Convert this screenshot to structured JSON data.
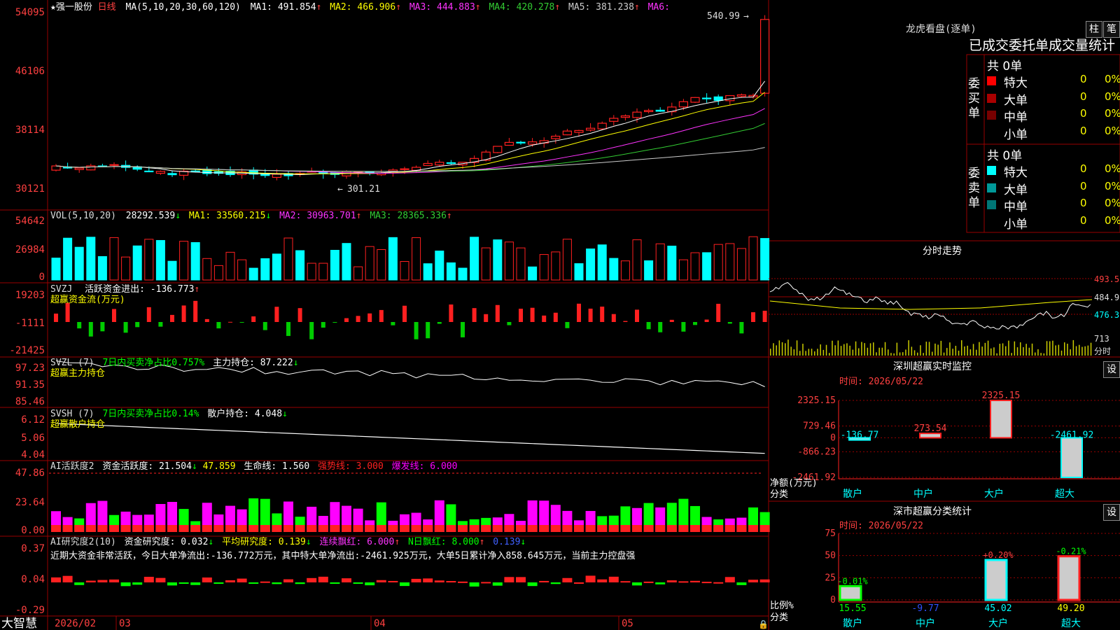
{
  "stock": {
    "name": "★强一股份",
    "period": "日线",
    "ma_label": "MA(5,10,20,30,60,120)"
  },
  "colors": {
    "up": "#ff2020",
    "down": "#00ffff",
    "ma1": "#ffffff",
    "ma2": "#ffff00",
    "ma3": "#ff33ff",
    "ma4": "#33cc33",
    "ma5": "#cccccc",
    "grid": "#800000",
    "magenta": "#ff00ff",
    "green": "#00ff00"
  },
  "main": {
    "y_ticks": [
      "54095",
      "46106",
      "38114",
      "30121"
    ],
    "ma_items": [
      {
        "label": "MA1: 491.854",
        "arrow": "↑",
        "color": "#ffffff"
      },
      {
        "label": "MA2: 466.906",
        "arrow": "↑",
        "color": "#ffff00"
      },
      {
        "label": "MA3: 444.883",
        "arrow": "↑",
        "color": "#ff33ff"
      },
      {
        "label": "MA4: 420.278",
        "arrow": "↑",
        "color": "#33cc33"
      },
      {
        "label": "MA5: 381.238",
        "arrow": "↑",
        "color": "#cccccc"
      },
      {
        "label": "MA6:",
        "arrow": "",
        "color": "#ff33ff"
      }
    ],
    "high_label": "540.99",
    "low_label": "301.21"
  },
  "vol": {
    "title": "VOL(5,10,20)",
    "value": "28292.539",
    "v_arrow": "↓",
    "ma1": "MA1: 33560.215",
    "ma1_arrow": "↓",
    "ma2": "MA2: 30963.701",
    "ma2_arrow": "↑",
    "ma3": "MA3: 28365.336",
    "ma3_arrow": "↑",
    "y_ticks": [
      "54642",
      "26984",
      "0"
    ]
  },
  "svzj": {
    "title": "SVZJ",
    "desc": "活跃资金进出: -136.773",
    "arrow": "↑",
    "sub": "超赢资金流(万元)",
    "y_ticks": [
      "19203",
      "-1111",
      "-21425"
    ]
  },
  "svzl": {
    "title": "SVZL (7)",
    "desc": "7日内买卖净占比0.757%",
    "value": "主力持仓: 87.222",
    "arrow": "↓",
    "sub": "超赢主力持仓",
    "y_ticks": [
      "97.23",
      "91.35",
      "85.46"
    ]
  },
  "svsh": {
    "title": "SVSH (7)",
    "desc": "7日内买卖净占比0.14%",
    "value": "散户持仓: 4.048",
    "arrow": "↓",
    "sub": "超赢散户持仓",
    "y_ticks": [
      "6.12",
      "5.06",
      "4.04"
    ]
  },
  "ai1": {
    "title": "AI活跃度2",
    "desc": "资金活跃度: 21.504",
    "arrow": "↓",
    "v2": "47.859",
    "v3": "生命线: 1.560",
    "v4": "强势线: 3.000",
    "v5": "爆发线: 6.000",
    "y_ticks": [
      "47.86",
      "23.64",
      "0.00"
    ]
  },
  "ai2": {
    "title": "AI研究度2(10)",
    "desc": "资金研究度: 0.032",
    "arrow": "↓",
    "avg": "平均研究度: 0.139",
    "avg_arrow": "↓",
    "red": "连续飘红: 6.000",
    "red_arrow": "↑",
    "nred": "N日飘红: 8.000",
    "nred_arrow": "↑",
    "last": "0.139",
    "last_arrow": "↓",
    "comment": "近期大资金非常活跃，今日大单净流出:-136.772万元，其中特大单净流出:-2461.925万元，大单5日累计净入858.645万元，当前主力控盘强",
    "y_ticks": [
      "0.37",
      "0.04",
      "-0.29"
    ]
  },
  "bottom": {
    "brand": "大智慧",
    "dates": [
      "2026/02",
      "03",
      "04",
      "05"
    ]
  },
  "dragon": {
    "title": "龙虎看盘(逐单)",
    "tab1": "柱",
    "tab2": "笔",
    "header": "已成交委托单成交量统计",
    "buy": {
      "label": "委买单",
      "total": "共 0单",
      "rows": [
        {
          "name": "特大",
          "count": "0",
          "pct": "0%",
          "color": "#ff0000"
        },
        {
          "name": "大单",
          "count": "0",
          "pct": "0%",
          "color": "#aa0000"
        },
        {
          "name": "中单",
          "count": "0",
          "pct": "0%",
          "color": "#770000"
        },
        {
          "name": "小单",
          "count": "0",
          "pct": "0%",
          "color": "#000000"
        }
      ]
    },
    "sell": {
      "label": "委卖单",
      "total": "共 0单",
      "rows": [
        {
          "name": "特大",
          "count": "0",
          "pct": "0%",
          "color": "#00ffff"
        },
        {
          "name": "大单",
          "count": "0",
          "pct": "0%",
          "color": "#009999"
        },
        {
          "name": "中单",
          "count": "0",
          "pct": "0%",
          "color": "#007777"
        },
        {
          "name": "小单",
          "count": "0",
          "pct": "0%",
          "color": "#000000"
        }
      ]
    }
  },
  "intraday": {
    "title": "分时走势",
    "y_ticks": [
      "493.5",
      "484.9",
      "476.3"
    ],
    "vol_tick": "713",
    "unit": "分时"
  },
  "monitor": {
    "title": "深圳超赢实时监控",
    "set": "设",
    "time": "时间: 2026/05/22",
    "y_ticks": [
      "2325.15",
      "729.46",
      "0",
      "-866.23",
      "-2461.92"
    ],
    "y_label1": "净额(万元)",
    "y_label2": "分类",
    "bars": [
      {
        "cat": "散户",
        "value": -136.77,
        "label": "-136.77"
      },
      {
        "cat": "中户",
        "value": 273.54,
        "label": "273.54"
      },
      {
        "cat": "大户",
        "value": 2325.15,
        "label": "2325.15"
      },
      {
        "cat": "超大",
        "value": -2461.92,
        "label": "-2461.92"
      }
    ]
  },
  "classify": {
    "title": "深市超赢分类统计",
    "set": "设",
    "time": "时间: 2026/05/22",
    "y_ticks": [
      "75",
      "50",
      "25",
      "0"
    ],
    "y_label1": "比例%",
    "y_label2": "分类",
    "bars": [
      {
        "cat": "散户",
        "value": 15.55,
        "label": "15.55",
        "chg": "-0.01%"
      },
      {
        "cat": "中户",
        "value": -9.77,
        "label": "-9.77",
        "chg": ""
      },
      {
        "cat": "大户",
        "value": 45.02,
        "label": "45.02",
        "chg": "+0.20%"
      },
      {
        "cat": "超大",
        "value": 49.2,
        "label": "49.20",
        "chg": "-0.21%"
      }
    ]
  }
}
